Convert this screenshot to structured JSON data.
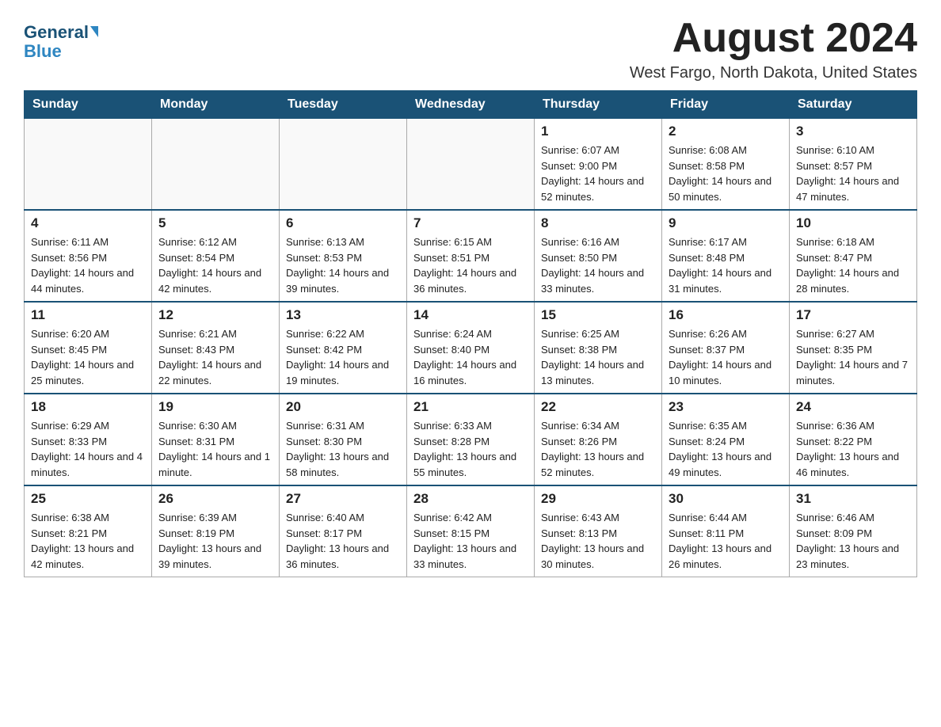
{
  "logo": {
    "general": "General",
    "blue": "Blue"
  },
  "header": {
    "title": "August 2024",
    "subtitle": "West Fargo, North Dakota, United States"
  },
  "days_of_week": [
    "Sunday",
    "Monday",
    "Tuesday",
    "Wednesday",
    "Thursday",
    "Friday",
    "Saturday"
  ],
  "weeks": [
    [
      {
        "day": "",
        "info": ""
      },
      {
        "day": "",
        "info": ""
      },
      {
        "day": "",
        "info": ""
      },
      {
        "day": "",
        "info": ""
      },
      {
        "day": "1",
        "info": "Sunrise: 6:07 AM\nSunset: 9:00 PM\nDaylight: 14 hours and 52 minutes."
      },
      {
        "day": "2",
        "info": "Sunrise: 6:08 AM\nSunset: 8:58 PM\nDaylight: 14 hours and 50 minutes."
      },
      {
        "day": "3",
        "info": "Sunrise: 6:10 AM\nSunset: 8:57 PM\nDaylight: 14 hours and 47 minutes."
      }
    ],
    [
      {
        "day": "4",
        "info": "Sunrise: 6:11 AM\nSunset: 8:56 PM\nDaylight: 14 hours and 44 minutes."
      },
      {
        "day": "5",
        "info": "Sunrise: 6:12 AM\nSunset: 8:54 PM\nDaylight: 14 hours and 42 minutes."
      },
      {
        "day": "6",
        "info": "Sunrise: 6:13 AM\nSunset: 8:53 PM\nDaylight: 14 hours and 39 minutes."
      },
      {
        "day": "7",
        "info": "Sunrise: 6:15 AM\nSunset: 8:51 PM\nDaylight: 14 hours and 36 minutes."
      },
      {
        "day": "8",
        "info": "Sunrise: 6:16 AM\nSunset: 8:50 PM\nDaylight: 14 hours and 33 minutes."
      },
      {
        "day": "9",
        "info": "Sunrise: 6:17 AM\nSunset: 8:48 PM\nDaylight: 14 hours and 31 minutes."
      },
      {
        "day": "10",
        "info": "Sunrise: 6:18 AM\nSunset: 8:47 PM\nDaylight: 14 hours and 28 minutes."
      }
    ],
    [
      {
        "day": "11",
        "info": "Sunrise: 6:20 AM\nSunset: 8:45 PM\nDaylight: 14 hours and 25 minutes."
      },
      {
        "day": "12",
        "info": "Sunrise: 6:21 AM\nSunset: 8:43 PM\nDaylight: 14 hours and 22 minutes."
      },
      {
        "day": "13",
        "info": "Sunrise: 6:22 AM\nSunset: 8:42 PM\nDaylight: 14 hours and 19 minutes."
      },
      {
        "day": "14",
        "info": "Sunrise: 6:24 AM\nSunset: 8:40 PM\nDaylight: 14 hours and 16 minutes."
      },
      {
        "day": "15",
        "info": "Sunrise: 6:25 AM\nSunset: 8:38 PM\nDaylight: 14 hours and 13 minutes."
      },
      {
        "day": "16",
        "info": "Sunrise: 6:26 AM\nSunset: 8:37 PM\nDaylight: 14 hours and 10 minutes."
      },
      {
        "day": "17",
        "info": "Sunrise: 6:27 AM\nSunset: 8:35 PM\nDaylight: 14 hours and 7 minutes."
      }
    ],
    [
      {
        "day": "18",
        "info": "Sunrise: 6:29 AM\nSunset: 8:33 PM\nDaylight: 14 hours and 4 minutes."
      },
      {
        "day": "19",
        "info": "Sunrise: 6:30 AM\nSunset: 8:31 PM\nDaylight: 14 hours and 1 minute."
      },
      {
        "day": "20",
        "info": "Sunrise: 6:31 AM\nSunset: 8:30 PM\nDaylight: 13 hours and 58 minutes."
      },
      {
        "day": "21",
        "info": "Sunrise: 6:33 AM\nSunset: 8:28 PM\nDaylight: 13 hours and 55 minutes."
      },
      {
        "day": "22",
        "info": "Sunrise: 6:34 AM\nSunset: 8:26 PM\nDaylight: 13 hours and 52 minutes."
      },
      {
        "day": "23",
        "info": "Sunrise: 6:35 AM\nSunset: 8:24 PM\nDaylight: 13 hours and 49 minutes."
      },
      {
        "day": "24",
        "info": "Sunrise: 6:36 AM\nSunset: 8:22 PM\nDaylight: 13 hours and 46 minutes."
      }
    ],
    [
      {
        "day": "25",
        "info": "Sunrise: 6:38 AM\nSunset: 8:21 PM\nDaylight: 13 hours and 42 minutes."
      },
      {
        "day": "26",
        "info": "Sunrise: 6:39 AM\nSunset: 8:19 PM\nDaylight: 13 hours and 39 minutes."
      },
      {
        "day": "27",
        "info": "Sunrise: 6:40 AM\nSunset: 8:17 PM\nDaylight: 13 hours and 36 minutes."
      },
      {
        "day": "28",
        "info": "Sunrise: 6:42 AM\nSunset: 8:15 PM\nDaylight: 13 hours and 33 minutes."
      },
      {
        "day": "29",
        "info": "Sunrise: 6:43 AM\nSunset: 8:13 PM\nDaylight: 13 hours and 30 minutes."
      },
      {
        "day": "30",
        "info": "Sunrise: 6:44 AM\nSunset: 8:11 PM\nDaylight: 13 hours and 26 minutes."
      },
      {
        "day": "31",
        "info": "Sunrise: 6:46 AM\nSunset: 8:09 PM\nDaylight: 13 hours and 23 minutes."
      }
    ]
  ]
}
